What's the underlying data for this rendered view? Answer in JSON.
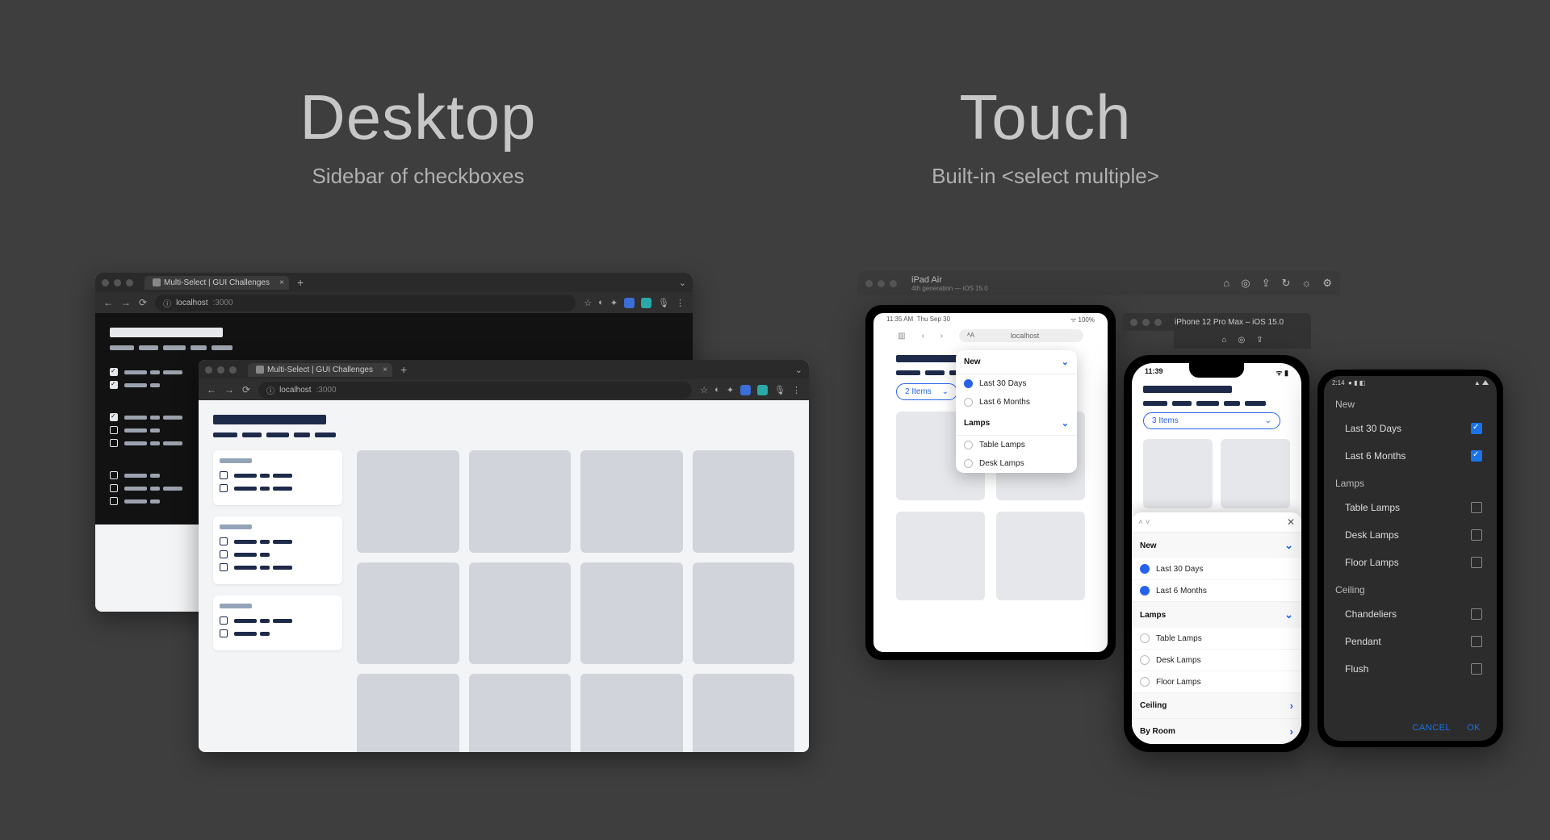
{
  "headings": {
    "desktop_title": "Desktop",
    "desktop_sub": "Sidebar of checkboxes",
    "touch_title": "Touch",
    "touch_sub": "Built-in <select multiple>"
  },
  "browser": {
    "tab_title": "Multi-Select | GUI Challenges",
    "url_host": "localhost",
    "url_port": ":3000"
  },
  "simulators": {
    "ipad_name": "iPad Air",
    "ipad_sub": "4th generation — iOS 15.0",
    "iphone_title": "iPhone 12 Pro Max – iOS 15.0"
  },
  "ipad": {
    "time": "11:35 AM",
    "date": "Thu Sep 30",
    "url_label": "localhost",
    "pill_label": "2 Items"
  },
  "iphone": {
    "time": "11:39",
    "pill_label": "3 Items"
  },
  "android": {
    "time": "2:14",
    "actions": {
      "cancel": "CANCEL",
      "ok": "OK"
    }
  },
  "filters": {
    "groups": [
      {
        "name": "New",
        "options": [
          {
            "label": "Last 30 Days",
            "ipad_on": true,
            "iphone_on": true,
            "android_on": true,
            "android_show": true
          },
          {
            "label": "Last 6 Months",
            "ipad_on": false,
            "iphone_on": true,
            "android_on": true,
            "android_show": true
          }
        ]
      },
      {
        "name": "Lamps",
        "options": [
          {
            "label": "Table Lamps",
            "ipad_on": false,
            "iphone_on": false,
            "android_on": false,
            "android_show": true
          },
          {
            "label": "Desk Lamps",
            "ipad_on": false,
            "iphone_on": false,
            "android_on": false,
            "android_show": true
          },
          {
            "label": "Floor Lamps",
            "ipad_on": false,
            "iphone_on": false,
            "android_on": false,
            "android_show": true
          }
        ]
      },
      {
        "name": "Ceiling",
        "options": [
          {
            "label": "Chandeliers",
            "android_on": false,
            "android_show": true
          },
          {
            "label": "Pendant",
            "android_on": false,
            "android_show": true
          },
          {
            "label": "Flush",
            "android_on": false,
            "android_show": true
          }
        ]
      },
      {
        "name": "By Room",
        "options": []
      }
    ]
  }
}
